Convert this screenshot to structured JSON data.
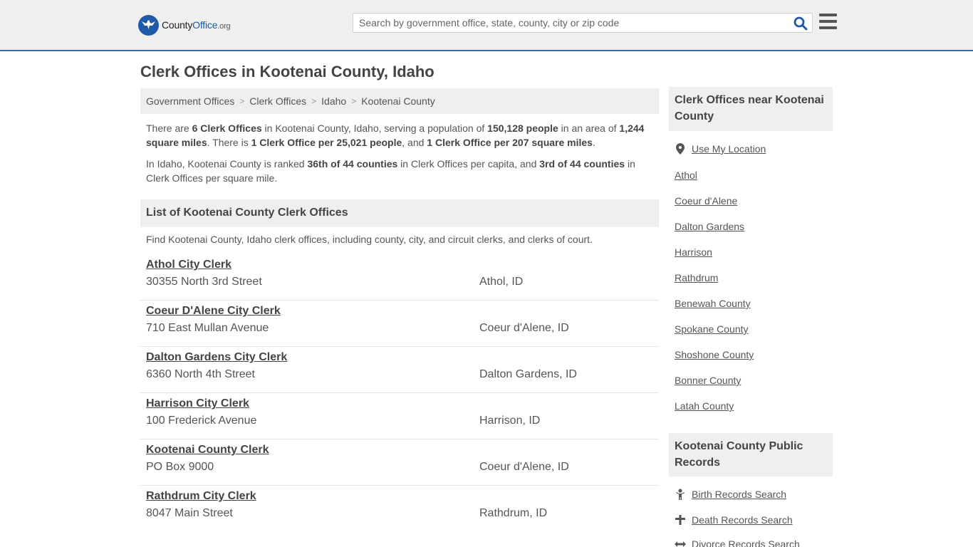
{
  "header": {
    "logo_name": "County",
    "logo_office": "Office",
    "logo_org": ".org",
    "search_placeholder": "Search by government office, state, county, city or zip code"
  },
  "page_title": "Clerk Offices in Kootenai County, Idaho",
  "breadcrumb": [
    "Government Offices",
    "Clerk Offices",
    "Idaho",
    "Kootenai County"
  ],
  "intro": {
    "p1": {
      "t1": "There are ",
      "b1": "6 Clerk Offices",
      "t2": " in Kootenai County, Idaho, serving a population of ",
      "b2": "150,128 people",
      "t3": " in an area of ",
      "b3": "1,244 square miles",
      "t4": ". There is ",
      "b4": "1 Clerk Office per 25,021 people",
      "t5": ", and ",
      "b5": "1 Clerk Office per 207 square miles",
      "t6": "."
    },
    "p2": {
      "t1": "In Idaho, Kootenai County is ranked ",
      "b1": "36th of 44 counties",
      "t2": " in Clerk Offices per capita, and ",
      "b2": "3rd of 44 counties",
      "t3": " in Clerk Offices per square mile."
    }
  },
  "list_heading": "List of Kootenai County Clerk Offices",
  "list_description": "Find Kootenai County, Idaho clerk offices, including county, city, and circuit clerks, and clerks of court.",
  "offices": [
    {
      "name": "Athol City Clerk",
      "address": "30355 North 3rd Street",
      "city": "Athol, ID"
    },
    {
      "name": "Coeur D'Alene City Clerk",
      "address": "710 East Mullan Avenue",
      "city": "Coeur d'Alene, ID"
    },
    {
      "name": "Dalton Gardens City Clerk",
      "address": "6360 North 4th Street",
      "city": "Dalton Gardens, ID"
    },
    {
      "name": "Harrison City Clerk",
      "address": "100 Frederick Avenue",
      "city": "Harrison, ID"
    },
    {
      "name": "Kootenai County Clerk",
      "address": "PO Box 9000",
      "city": "Coeur d'Alene, ID"
    },
    {
      "name": "Rathdrum City Clerk",
      "address": "8047 Main Street",
      "city": "Rathdrum, ID"
    }
  ],
  "sidebar": {
    "nearby_heading": "Clerk Offices near Kootenai County",
    "use_location": "Use My Location",
    "nearby_links": [
      "Athol",
      "Coeur d'Alene",
      "Dalton Gardens",
      "Harrison",
      "Rathdrum",
      "Benewah County",
      "Spokane County",
      "Shoshone County",
      "Bonner County",
      "Latah County"
    ],
    "records_heading": "Kootenai County Public Records",
    "records_links": [
      "Birth Records Search",
      "Death Records Search",
      "Divorce Records Search"
    ]
  }
}
